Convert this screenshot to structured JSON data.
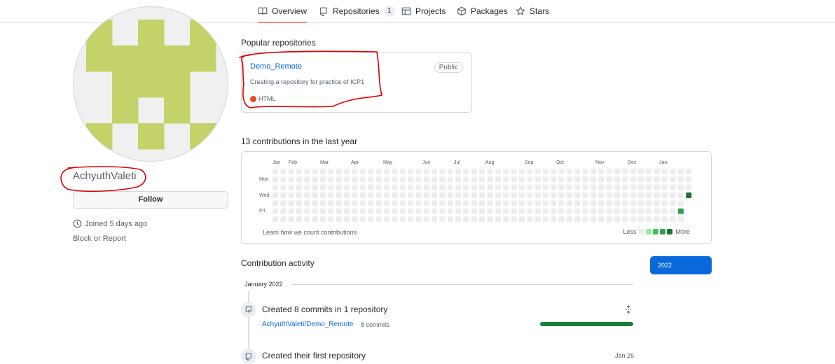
{
  "nav": {
    "tabs": [
      {
        "label": "Overview",
        "icon": "book-icon",
        "active": true
      },
      {
        "label": "Repositories",
        "icon": "repo-icon",
        "count": "1"
      },
      {
        "label": "Projects",
        "icon": "table-icon"
      },
      {
        "label": "Packages",
        "icon": "package-icon"
      },
      {
        "label": "Stars",
        "icon": "star-icon"
      }
    ]
  },
  "profile": {
    "username": "AchyuthValeti",
    "follow_label": "Follow",
    "joined": "Joined 5 days ago",
    "block_label": "Block or Report",
    "avatar_color": "#c5d26a"
  },
  "popular": {
    "title": "Popular repositories",
    "repo": {
      "name": "Demo_Remote",
      "badge": "Public",
      "description": "Creating a repository for practice of ICP1",
      "language": "HTML",
      "language_color": "#e34c26"
    }
  },
  "contributions": {
    "title": "13 contributions in the last year",
    "months": [
      "Jan",
      "Feb",
      "Mar",
      "Apr",
      "May",
      "Jun",
      "Jul",
      "Aug",
      "Sep",
      "Oct",
      "Nov",
      "Dec",
      "Jan"
    ],
    "days": [
      "Mon",
      "Wed",
      "Fri"
    ],
    "learn_link": "Learn how we count contributions",
    "legend_less": "Less",
    "legend_more": "More",
    "legend_colors": [
      "#ebedf0",
      "#9be9a8",
      "#40c463",
      "#30a14e",
      "#216e39"
    ],
    "cells": [
      {
        "week": 52,
        "day": 3,
        "level": 4
      },
      {
        "week": 51,
        "day": 5,
        "level": 3
      }
    ]
  },
  "activity": {
    "title": "Contribution activity",
    "year": "2022",
    "month": "January 2022",
    "items": [
      {
        "title": "Created 8 commits in 1 repository",
        "repo": "AchyuthValeti/Demo_Remote",
        "count": "8 commits"
      },
      {
        "title": "Created their first repository",
        "date": "Jan 26"
      }
    ]
  },
  "colors": {
    "accent": "#0969da",
    "annotation": "#e00000",
    "progress": "#1a7f37"
  }
}
